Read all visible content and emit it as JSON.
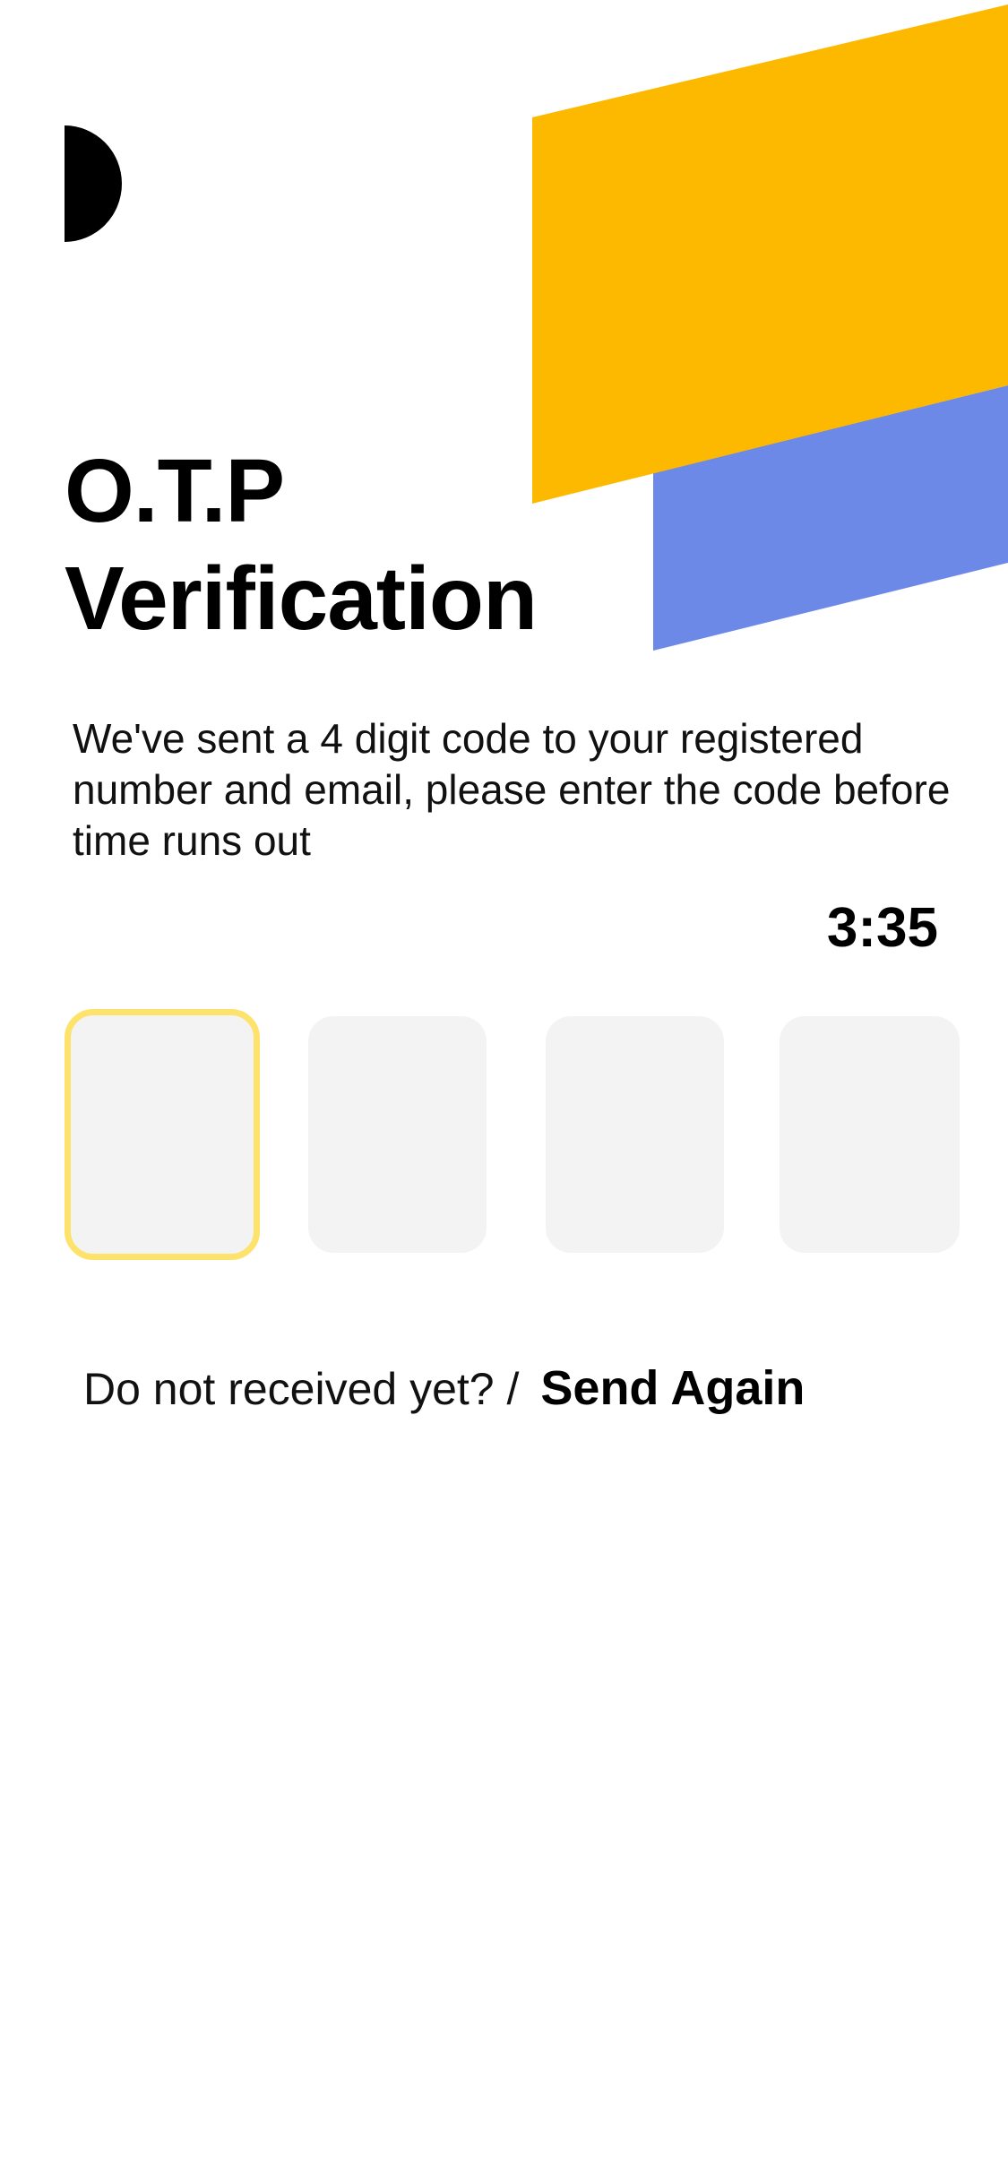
{
  "header": {
    "title_line1": "O.T.P",
    "title_line2": "Verification"
  },
  "description": "We've sent a 4 digit code to your registered number and email, please enter the code before time runs out",
  "timer": "3:35",
  "otp": {
    "digits": [
      "",
      "",
      "",
      ""
    ],
    "active_index": 0
  },
  "resend": {
    "prompt": "Do not received yet? /",
    "link_label": "Send Again"
  },
  "colors": {
    "accent_yellow": "#FDB900",
    "accent_blue": "#6C89E7",
    "focus_border": "#FDE26B",
    "box_fill": "#F3F3F3"
  },
  "icons": {
    "logo": "half-circle-logo-icon"
  }
}
